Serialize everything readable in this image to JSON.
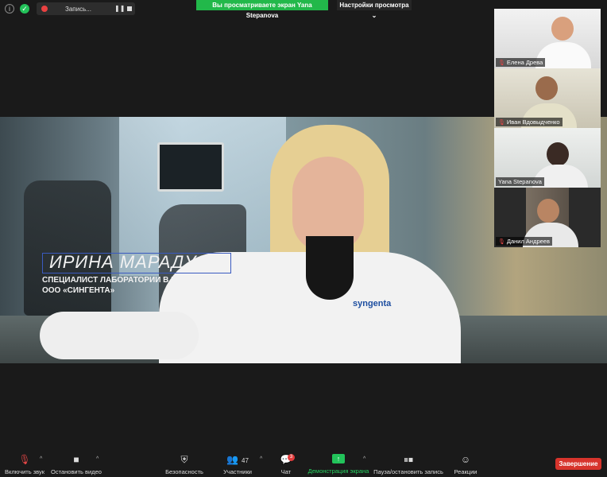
{
  "topbar": {
    "recording_label": "Запись...",
    "viewing_banner": "Вы просматриваете экран Yana Stepanova",
    "view_options": "Настройки просмотра"
  },
  "share": {
    "name_title": "ИРИНА МАРАДУДА",
    "subtitle_line1": "СПЕЦИАЛИСТ ЛАБОРАТОРИИ В КРАСНОДАРЕ",
    "subtitle_line2": "ООО «СИНГЕНТА»",
    "coat_logo": "syngenta"
  },
  "participants": [
    {
      "name": "Елена Древа",
      "muted": true
    },
    {
      "name": "Иван Вдовыдченко",
      "muted": true
    },
    {
      "name": "Yana Stepanova",
      "muted": false
    },
    {
      "name": "Данил Андреев",
      "muted": true
    }
  ],
  "toolbar": {
    "unmute": "Включить звук",
    "stop_video": "Остановить видео",
    "security": "Безопасность",
    "participants": "Участники",
    "participants_count": "47",
    "chat": "Чат",
    "chat_badge": "3",
    "share_screen": "Демонстрация экрана",
    "pause_recording": "Пауза/остановить запись",
    "reactions": "Реакции",
    "end": "Завершение"
  },
  "colors": {
    "accent_green": "#22b84a",
    "end_red": "#d7342c"
  }
}
